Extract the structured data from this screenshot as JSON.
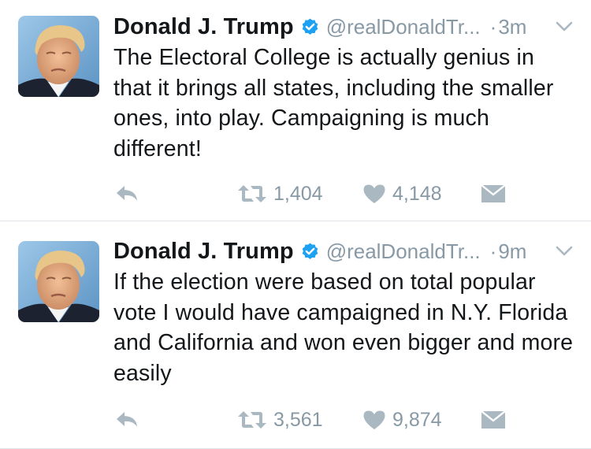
{
  "tweets": [
    {
      "name": "Donald J. Trump",
      "handle": "@realDonaldTr...",
      "separator": "·",
      "time": "3m",
      "text": "The Electoral College is actually genius in that it brings all states, including the smaller ones, into play. Campaigning is much different!",
      "retweets": "1,404",
      "likes": "4,148"
    },
    {
      "name": "Donald J. Trump",
      "handle": "@realDonaldTr...",
      "separator": "·",
      "time": "9m",
      "text": "If the election were based on total popular vote I would have campaigned in N.Y. Florida and California and won even bigger and more easily",
      "retweets": "3,561",
      "likes": "9,874"
    }
  ],
  "icons": {
    "verified": "verified-badge-icon",
    "menu": "chevron-down-icon",
    "reply": "reply-icon",
    "retweet": "retweet-icon",
    "like": "heart-icon",
    "dm": "envelope-icon"
  },
  "colors": {
    "text": "#14171a",
    "muted": "#8899a6",
    "verified": "#1da1f2",
    "icon": "#aab8c2",
    "divider": "#dfe3e8"
  }
}
